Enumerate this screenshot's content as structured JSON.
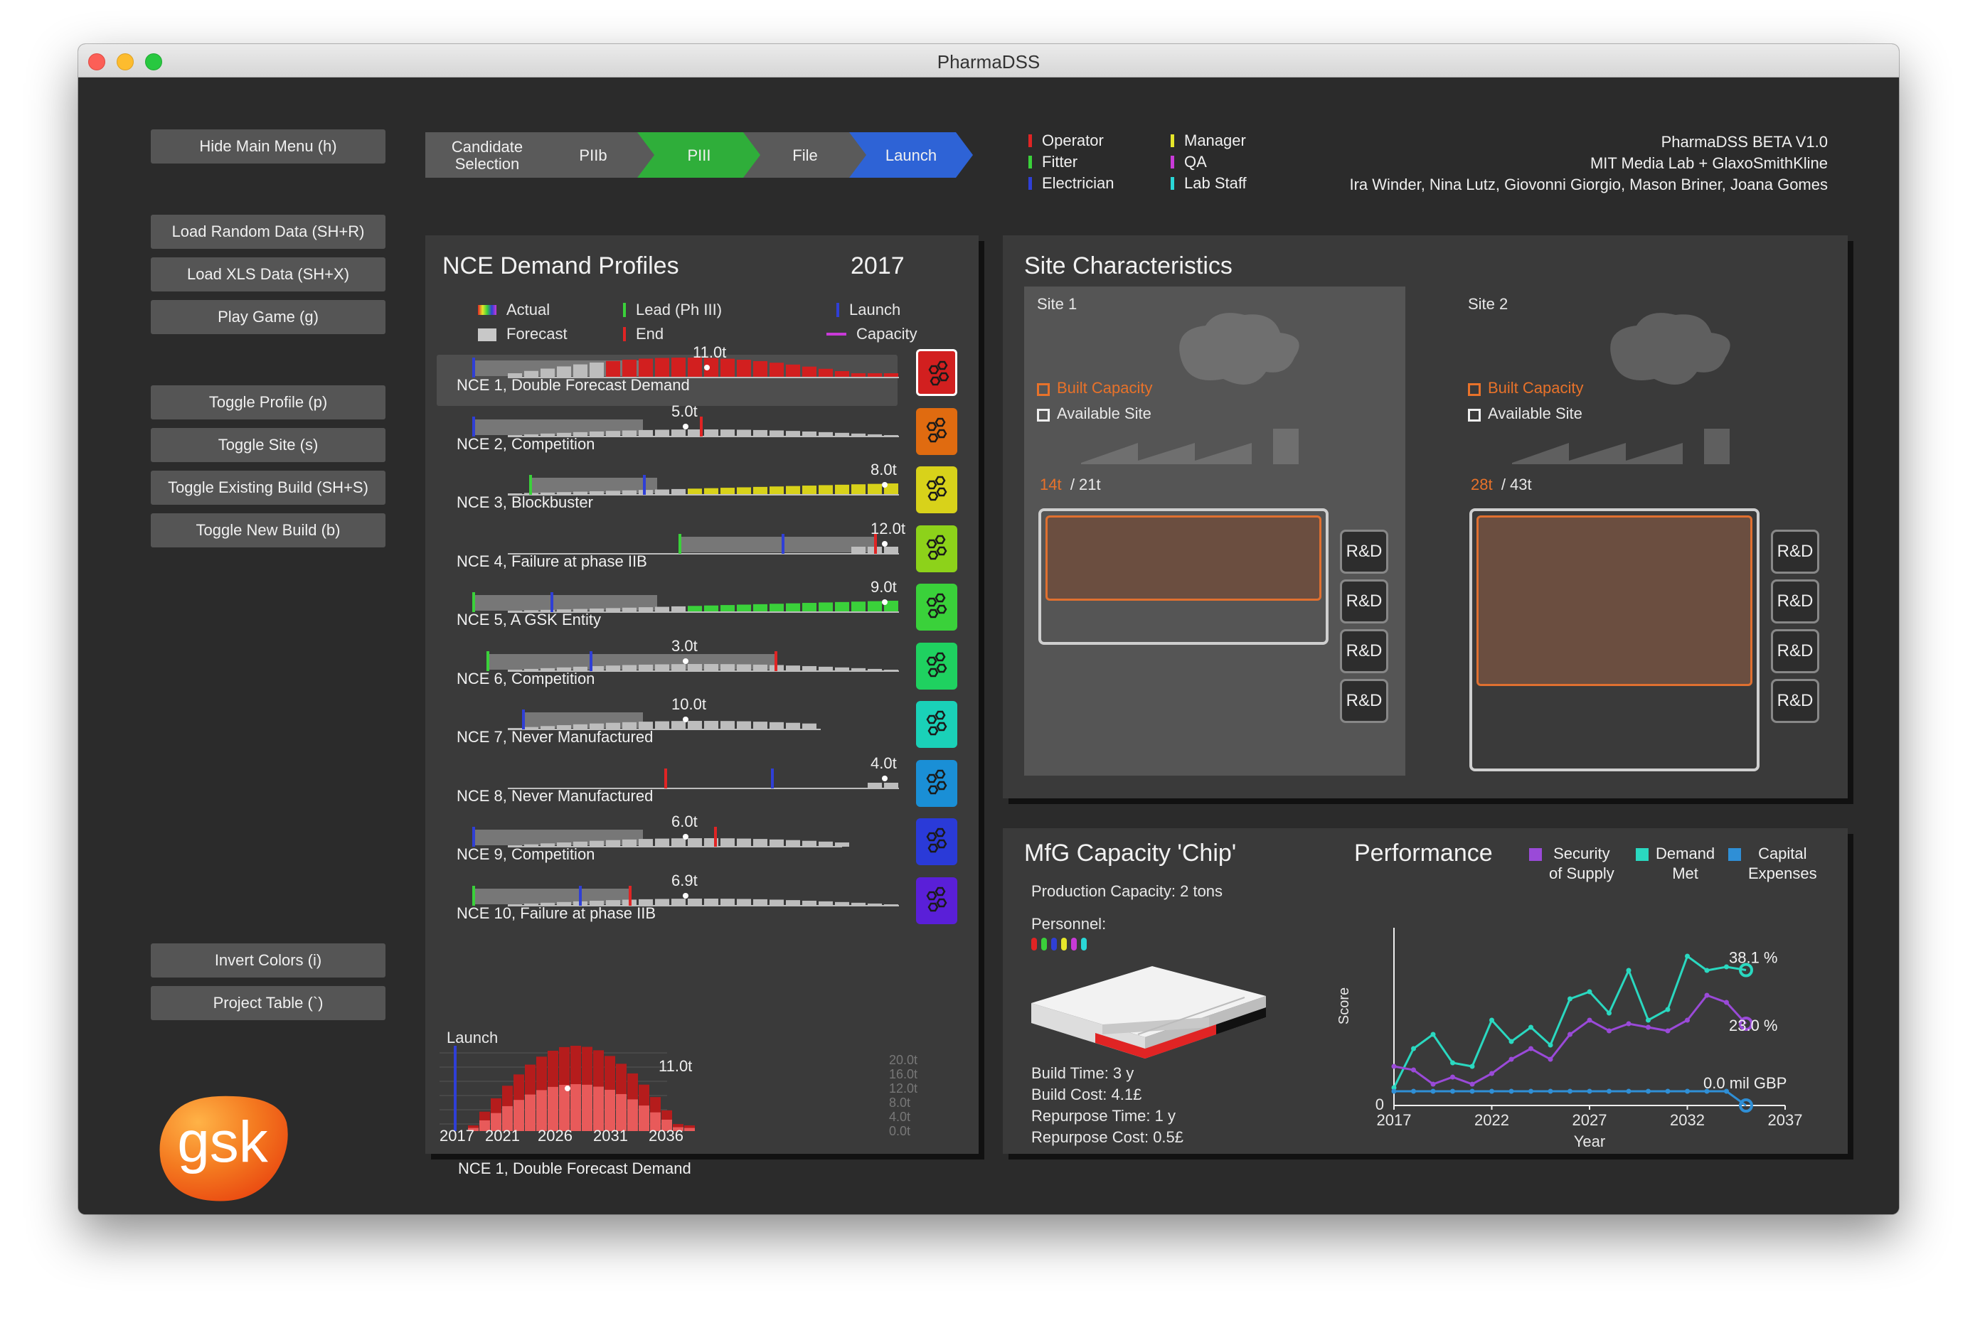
{
  "window": {
    "title": "PharmaDSS"
  },
  "menu": {
    "hide": "Hide Main Menu (h)",
    "load_random": "Load Random Data (SH+R)",
    "load_xls": "Load XLS Data (SH+X)",
    "play": "Play Game (g)",
    "toggle_profile": "Toggle Profile (p)",
    "toggle_site": "Toggle Site (s)",
    "toggle_existing": "Toggle Existing Build (SH+S)",
    "toggle_new": "Toggle New Build (b)",
    "invert": "Invert Colors (i)",
    "project_table": "Project Table (`)"
  },
  "logo": {
    "text": "gsk"
  },
  "stages": [
    {
      "label": "Candidate\nSelection",
      "color": "#5a5a5a"
    },
    {
      "label": "PIIb",
      "color": "#5a5a5a"
    },
    {
      "label": "PIII",
      "color": "#2fae3a"
    },
    {
      "label": "File",
      "color": "#5a5a5a"
    },
    {
      "label": "Launch",
      "color": "#2e63d6"
    }
  ],
  "roles": [
    {
      "label": "Operator",
      "color": "#e02424"
    },
    {
      "label": "Fitter",
      "color": "#3ad13a"
    },
    {
      "label": "Electrician",
      "color": "#2f3fd6"
    },
    {
      "label": "Manager",
      "color": "#e6e62a"
    },
    {
      "label": "QA",
      "color": "#c93ad8"
    },
    {
      "label": "Lab Staff",
      "color": "#2ad8d8"
    }
  ],
  "credits": {
    "version": "PharmaDSS BETA V1.0",
    "org": "MIT Media Lab + GlaxoSmithKline",
    "authors": "Ira Winder, Nina Lutz, Giovonni Giorgio, Mason Briner, Joana Gomes"
  },
  "demand": {
    "title": "NCE Demand Profiles",
    "year": "2017",
    "legend": {
      "actual": "Actual",
      "forecast": "Forecast",
      "lead": "Lead (Ph III)",
      "end": "End",
      "launch": "Launch",
      "capacity": "Capacity"
    },
    "rows": [
      {
        "label": "NCE 1, Double Forecast Demand",
        "peak": "11.0t",
        "color": "#d21f1f"
      },
      {
        "label": "NCE 2, Competition",
        "peak": "5.0t",
        "color": "#e06b10"
      },
      {
        "label": "NCE 3, Blockbuster",
        "peak": "8.0t",
        "color": "#d8d21a"
      },
      {
        "label": "NCE 4, Failure at phase IIB",
        "peak": "12.0t",
        "color": "#8dd21a"
      },
      {
        "label": "NCE 5, A GSK Entity",
        "peak": "9.0t",
        "color": "#3ad13a"
      },
      {
        "label": "NCE 6, Competition",
        "peak": "3.0t",
        "color": "#1fd160"
      },
      {
        "label": "NCE 7, Never Manufactured",
        "peak": "10.0t",
        "color": "#1ad1b8"
      },
      {
        "label": "NCE 8, Never Manufactured",
        "peak": "4.0t",
        "color": "#1a8fd6"
      },
      {
        "label": "NCE 9, Competition",
        "peak": "6.0t",
        "color": "#2a3ad8"
      },
      {
        "label": "NCE 10, Failure at phase IIB",
        "peak": "6.9t",
        "color": "#5a1fd8"
      }
    ],
    "detail": {
      "launch_label": "Launch",
      "peak": "11.0t",
      "caption": "NCE 1, Double Forecast Demand",
      "yticks": [
        "20.0t",
        "16.0t",
        "12.0t",
        "8.0t",
        "4.0t",
        "0.0t"
      ],
      "xticks": [
        "2017",
        "2021",
        "2026",
        "2031",
        "2036"
      ]
    }
  },
  "sites": {
    "title": "Site Characteristics",
    "legend_built": "Built Capacity",
    "legend_available": "Available Site",
    "rnd": "R&D",
    "site1": {
      "name": "Site 1",
      "built": "14t",
      "total": "/ 21t"
    },
    "site2": {
      "name": "Site 2",
      "built": "28t",
      "total": "/ 43t"
    }
  },
  "chip": {
    "title": "MfG Capacity 'Chip'",
    "production": "Production Capacity: 2 tons",
    "personnel": "Personnel:",
    "build_time": "Build Time: 3 y",
    "build_cost": "Build Cost: 4.1£",
    "repurpose_time": "Repurpose Time: 1 y",
    "repurpose_cost": "Repurpose Cost: 0.5£"
  },
  "performance": {
    "title": "Performance",
    "legend": [
      {
        "label": "Security\nof Supply",
        "color": "#9a4ad8"
      },
      {
        "label": "Demand\nMet",
        "color": "#2ad8c0"
      },
      {
        "label": "Capital\nExpenses",
        "color": "#2f8fd6"
      }
    ],
    "ylabel": "Score",
    "xlabel": "Year",
    "zero": "0",
    "xticks": [
      "2017",
      "2022",
      "2027",
      "2032",
      "2037"
    ],
    "end_labels": {
      "demand": "38.1 %",
      "security": "23.0 %",
      "capex": "0.0 mil GBP"
    }
  },
  "chart_data": {
    "type": "line",
    "xlabel": "Year",
    "ylabel": "Score",
    "x": [
      2017,
      2018,
      2019,
      2020,
      2021,
      2022,
      2023,
      2024,
      2025,
      2026,
      2027,
      2028,
      2029,
      2030,
      2031,
      2032,
      2033,
      2034,
      2035
    ],
    "series": [
      {
        "name": "Demand Met",
        "values": [
          5,
          16,
          20,
          12,
          11,
          24,
          18,
          22,
          17,
          30,
          32,
          26,
          38,
          24,
          27,
          42,
          38,
          39,
          38.1
        ]
      },
      {
        "name": "Security of Supply",
        "values": [
          11,
          10,
          6,
          8,
          6,
          9,
          13,
          16,
          13,
          20,
          24,
          21,
          23,
          22,
          21,
          24,
          31,
          29,
          23.0
        ]
      },
      {
        "name": "Capital Expenses",
        "values": [
          4,
          4,
          4,
          4,
          4,
          4,
          4,
          4,
          4,
          4,
          4,
          4,
          4,
          4,
          4,
          4,
          4,
          4,
          0
        ]
      }
    ]
  }
}
